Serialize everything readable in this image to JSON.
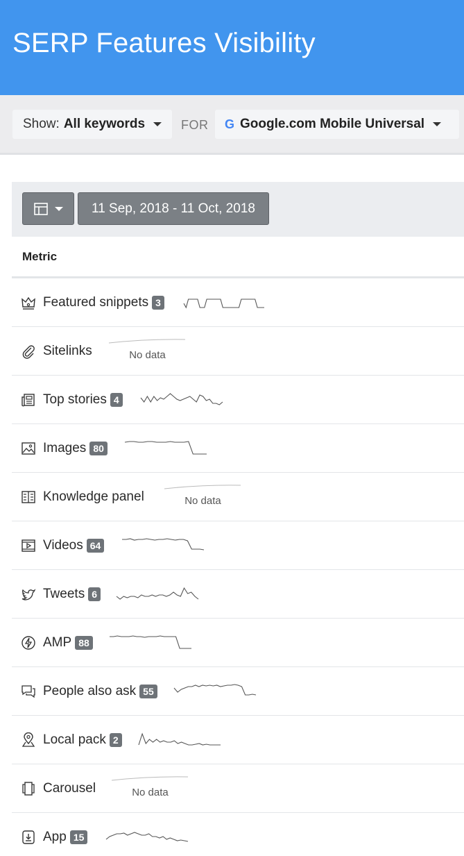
{
  "header": {
    "title": "SERP Features Visibility"
  },
  "filters": {
    "show_label": "Show:",
    "show_value": "All keywords",
    "for_label": "FOR",
    "engine_icon": "G",
    "engine_value": "Google.com Mobile Universal"
  },
  "toolbar": {
    "date_range": "11 Sep, 2018 - 11 Oct, 2018"
  },
  "table": {
    "column_header": "Metric",
    "rows": [
      {
        "label": "Featured snippets",
        "count": "3",
        "icon": "crown-icon",
        "spark": [
          0.6,
          0.9,
          0.3,
          0.3,
          0.3,
          0.3,
          0.3,
          0.9,
          0.9,
          0.9,
          0.3,
          0.3,
          0.3,
          0.3,
          0.3,
          0.3,
          0.3,
          0.9,
          0.9,
          0.9,
          0.9,
          0.9,
          0.9,
          0.9,
          0.9,
          0.3,
          0.3,
          0.3,
          0.3,
          0.3,
          0.3,
          0.3,
          0.9,
          0.9,
          0.9,
          0.9
        ]
      },
      {
        "label": "Sitelinks",
        "no_data": "No data",
        "icon": "paperclip-icon"
      },
      {
        "label": "Top stories",
        "count": "4",
        "icon": "newspaper-icon",
        "spark": [
          0.4,
          0.7,
          0.3,
          0.7,
          0.3,
          0.6,
          0.4,
          0.5,
          0.3,
          0.1,
          0.3,
          0.5,
          0.6,
          0.5,
          0.4,
          0.3,
          0.5,
          0.7,
          0.2,
          0.3,
          0.6,
          0.5,
          0.8,
          0.8,
          0.9,
          0.7
        ]
      },
      {
        "label": "Images",
        "count": "80",
        "icon": "image-icon",
        "spark": [
          0.1,
          0.05,
          0.05,
          0.1,
          0.1,
          0.05,
          0.05,
          0.1,
          0.1,
          0.1,
          0.05,
          0.1,
          0.1,
          0.1,
          0.05,
          0.95,
          0.95,
          0.95,
          0.95
        ]
      },
      {
        "label": "Knowledge panel",
        "no_data": "No data",
        "icon": "book-icon"
      },
      {
        "label": "Videos",
        "count": "64",
        "icon": "video-icon",
        "spark": [
          0.1,
          0.1,
          0.05,
          0.15,
          0.1,
          0.1,
          0.05,
          0.1,
          0.15,
          0.1,
          0.1,
          0.05,
          0.1,
          0.15,
          0.1,
          0.1,
          0.2,
          0.8,
          0.8,
          0.8,
          0.85
        ]
      },
      {
        "label": "Tweets",
        "count": "6",
        "icon": "bird-icon",
        "spark": [
          0.7,
          0.9,
          0.7,
          0.8,
          0.7,
          0.7,
          0.8,
          0.6,
          0.7,
          0.7,
          0.6,
          0.7,
          0.6,
          0.6,
          0.7,
          0.6,
          0.4,
          0.6,
          0.7,
          0.1,
          0.5,
          0.4,
          0.7,
          0.9
        ]
      },
      {
        "label": "AMP",
        "count": "88",
        "icon": "lightning-icon",
        "spark": [
          0.1,
          0.1,
          0.05,
          0.1,
          0.1,
          0.1,
          0.05,
          0.1,
          0.1,
          0.15,
          0.1,
          0.1,
          0.1,
          0.05,
          0.1,
          0.1,
          0.1,
          0.1,
          0.95,
          0.95,
          0.95,
          0.95
        ]
      },
      {
        "label": "People also ask",
        "count": "55",
        "icon": "chat-icon",
        "spark": [
          0.3,
          0.6,
          0.4,
          0.3,
          0.2,
          0.2,
          0.1,
          0.2,
          0.1,
          0.15,
          0.1,
          0.15,
          0.1,
          0.2,
          0.15,
          0.1,
          0.1,
          0.05,
          0.1,
          0.2,
          0.8,
          0.8,
          0.75,
          0.8
        ]
      },
      {
        "label": "Local pack",
        "count": "2",
        "icon": "pin-icon",
        "spark": [
          0.9,
          0.1,
          0.8,
          0.5,
          0.7,
          0.5,
          0.7,
          0.6,
          0.7,
          0.7,
          0.6,
          0.8,
          0.7,
          0.8,
          0.9,
          0.9,
          0.85,
          0.8,
          0.9,
          0.85,
          0.9,
          0.9,
          0.9,
          0.9
        ]
      },
      {
        "label": "Carousel",
        "no_data": "No data",
        "icon": "carousel-icon"
      },
      {
        "label": "App",
        "count": "15",
        "icon": "download-icon",
        "spark": [
          0.7,
          0.5,
          0.4,
          0.3,
          0.3,
          0.25,
          0.4,
          0.3,
          0.2,
          0.3,
          0.4,
          0.4,
          0.3,
          0.5,
          0.5,
          0.6,
          0.5,
          0.7,
          0.6,
          0.7,
          0.8,
          0.75,
          0.8,
          0.85
        ]
      }
    ]
  },
  "colors": {
    "header": "#4195ee",
    "badge": "#6e7378",
    "button": "#7b8085",
    "sparkline": "#555555"
  }
}
